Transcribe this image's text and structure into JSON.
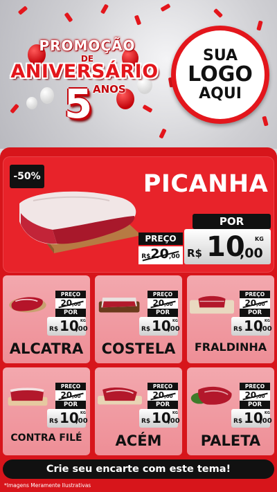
{
  "header": {
    "promo_title": "PROMOÇÃO",
    "promo_de": "DE",
    "promo_aniversario": "ANIVERSÁRIO",
    "promo_number": "5",
    "promo_anos": "ANOS",
    "logo_line1": "SUA",
    "logo_line2": "LOGO",
    "logo_line3": "AQUI"
  },
  "featured": {
    "discount": "-50%",
    "name": "PICANHA",
    "preco_label": "PREÇO",
    "old_prefix": "R$",
    "old_int": "20",
    "old_dec": ",00",
    "por_label": "POR",
    "currency": "R$",
    "new_int": "10",
    "new_dec": ",00",
    "unit": "KG"
  },
  "products": [
    {
      "name": "ALCATRA",
      "preco_label": "PREÇO",
      "old_int": "20",
      "old_dec": ",00",
      "por_label": "POR",
      "currency": "R$",
      "new_int": "10",
      "new_dec": ",00",
      "unit": "KG"
    },
    {
      "name": "COSTELA",
      "preco_label": "PREÇO",
      "old_int": "20",
      "old_dec": ",00",
      "por_label": "POR",
      "currency": "R$",
      "new_int": "10",
      "new_dec": ",00",
      "unit": "KG"
    },
    {
      "name": "FRALDINHA",
      "preco_label": "PREÇO",
      "old_int": "20",
      "old_dec": ",00",
      "por_label": "POR",
      "currency": "R$",
      "new_int": "10",
      "new_dec": ",00",
      "unit": "KG"
    },
    {
      "name": "CONTRA FILÉ",
      "preco_label": "PREÇO",
      "old_int": "20",
      "old_dec": ",00",
      "por_label": "POR",
      "currency": "R$",
      "new_int": "10",
      "new_dec": ",00",
      "unit": "KG"
    },
    {
      "name": "ACÉM",
      "preco_label": "PREÇO",
      "old_int": "20",
      "old_dec": ",00",
      "por_label": "POR",
      "currency": "R$",
      "new_int": "10",
      "new_dec": ",00",
      "unit": "KG"
    },
    {
      "name": "PALETA",
      "preco_label": "PREÇO",
      "old_int": "20",
      "old_dec": ",00",
      "por_label": "POR",
      "currency": "R$",
      "new_int": "10",
      "new_dec": ",00",
      "unit": "KG"
    }
  ],
  "footer": {
    "cta": "Crie seu encarte com este tema!",
    "disclaimer": "*Imagens Meramente Ilustrativas"
  },
  "colors": {
    "brand_red": "#d7151b",
    "card_pink": "#f19aa2",
    "black": "#111111"
  }
}
